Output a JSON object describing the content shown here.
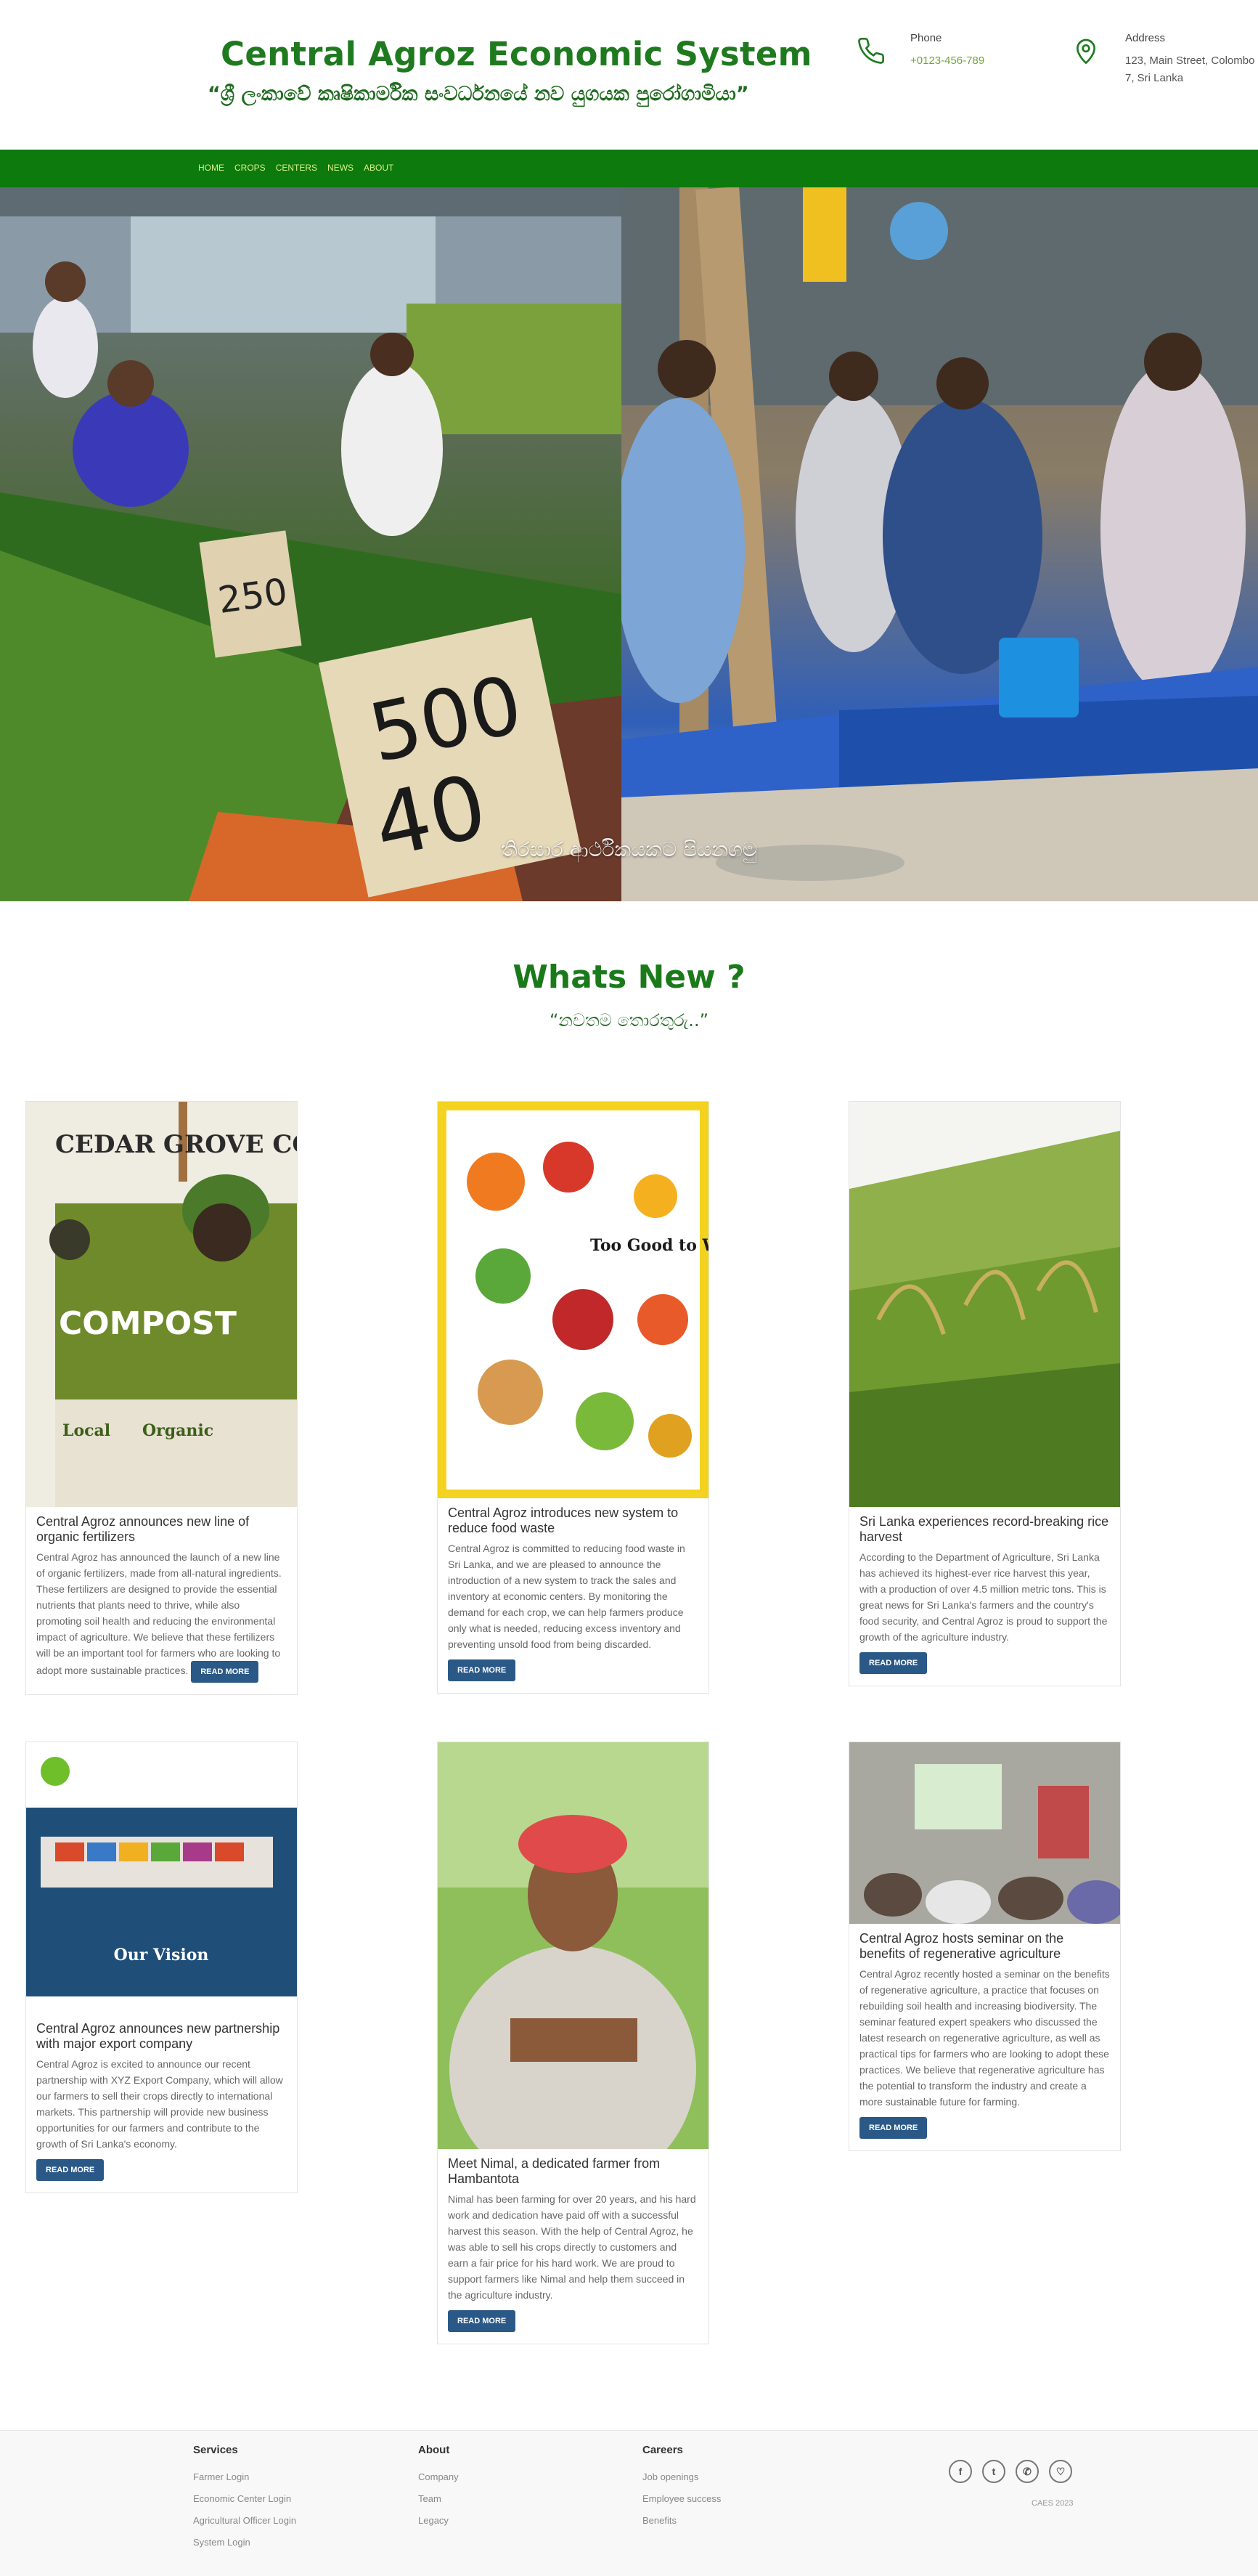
{
  "header": {
    "title": "Central Agroz Economic System",
    "tagline": "“ශ්‍රී ලංකාවේ කෘෂිකාර්මික සංවර්ධනයේ නව යුගයක පුරෝගාමියා”",
    "phone_label": "Phone",
    "phone_value": "+0123-456-789",
    "address_label": "Address",
    "address_value": "123, Main Street, Colombo 7, Sri Lanka"
  },
  "nav": {
    "items": [
      "HOME",
      "CROPS",
      "CENTERS",
      "NEWS",
      "ABOUT"
    ]
  },
  "hero": {
    "caption": "තිරසාර ආර්ථිකයකට පියනගමු"
  },
  "whats_new": {
    "title": "Whats New ?",
    "subtitle": "“නවතම තොරතුරු..”"
  },
  "cards": [
    {
      "title": "Central Agroz announces new line of organic fertilizers",
      "text": "Central Agroz has announced the launch of a new line of organic fertilizers, made from all-natural ingredients. These fertilizers are designed to provide the essential nutrients that plants need to thrive, while also promoting soil health and reducing the environmental impact of agriculture. We believe that these fertilizers will be an important tool for farmers who are looking to adopt more sustainable practices.",
      "button": "READ MORE",
      "image_label": "CEDAR GROVE COMPOST"
    },
    {
      "title": "Central Agroz introduces new system to reduce food waste",
      "text": "Central Agroz is committed to reducing food waste in Sri Lanka, and we are pleased to announce the introduction of a new system to track the sales and inventory at economic centers. By monitoring the demand for each crop, we can help farmers produce only what is needed, reducing excess inventory and preventing unsold food from being discarded.",
      "button": "READ MORE",
      "image_label": "Too Good to Waste"
    },
    {
      "title": "Sri Lanka experiences record-breaking rice harvest",
      "text": "According to the Department of Agriculture, Sri Lanka has achieved its highest-ever rice harvest this year, with a production of over 4.5 million metric tons. This is great news for Sri Lanka's farmers and the country's food security, and Central Agroz is proud to support the growth of the agriculture industry.",
      "button": "READ MORE"
    },
    {
      "title": "Central Agroz announces new partnership with major export company",
      "text": "Central Agroz is excited to announce our recent partnership with XYZ Export Company, which will allow our farmers to sell their crops directly to international markets. This partnership will provide new business opportunities for our farmers and contribute to the growth of Sri Lanka's economy.",
      "button": "READ MORE",
      "image_label": "Our Vision"
    },
    {
      "title": "Meet Nimal, a dedicated farmer from Hambantota",
      "text": "Nimal has been farming for over 20 years, and his hard work and dedication have paid off with a successful harvest this season. With the help of Central Agroz, he was able to sell his crops directly to customers and earn a fair price for his hard work. We are proud to support farmers like Nimal and help them succeed in the agriculture industry.",
      "button": "READ MORE"
    },
    {
      "title": "Central Agroz hosts seminar on the benefits of regenerative agriculture",
      "text": "Central Agroz recently hosted a seminar on the benefits of regenerative agriculture, a practice that focuses on rebuilding soil health and increasing biodiversity. The seminar featured expert speakers who discussed the latest research on regenerative agriculture, as well as practical tips for farmers who are looking to adopt these practices. We believe that regenerative agriculture has the potential to transform the industry and create a more sustainable future for farming.",
      "button": "READ MORE"
    }
  ],
  "footer": {
    "services_title": "Services",
    "services": [
      "Farmer Login",
      "Economic Center Login",
      "Agricultural Officer Login",
      "System Login"
    ],
    "about_title": "About",
    "about": [
      "Company",
      "Team",
      "Legacy"
    ],
    "careers_title": "Careers",
    "careers": [
      "Job openings",
      "Employee success",
      "Benefits"
    ],
    "copyright": "CAES 2023",
    "social_icons": [
      "facebook-icon",
      "twitter-icon",
      "whatsapp-icon",
      "heart-hand-icon"
    ]
  },
  "colors": {
    "brand_green": "#1f7a1f",
    "nav_green": "#0c7a0c",
    "nav_link": "#d9f08a",
    "button_blue": "#2b5987",
    "phone_green": "#6fa832"
  }
}
